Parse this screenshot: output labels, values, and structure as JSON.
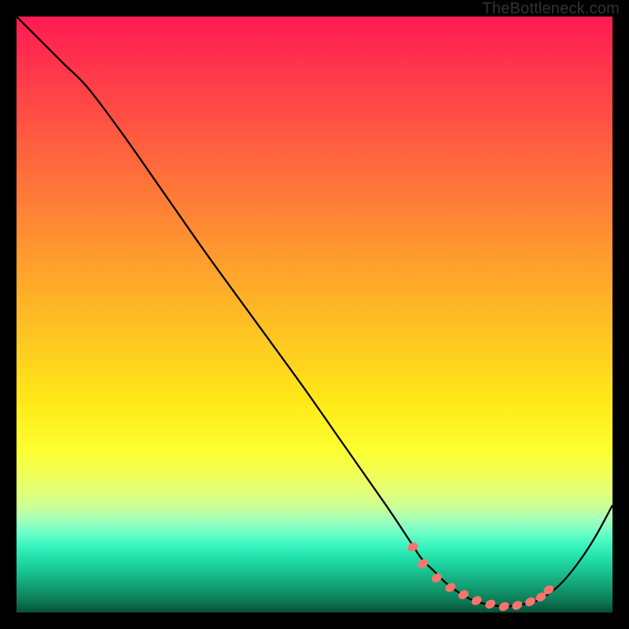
{
  "attribution": "TheBottleneck.com",
  "chart_data": {
    "type": "line",
    "title": "",
    "xlabel": "",
    "ylabel": "",
    "xlim": [
      0,
      100
    ],
    "ylim": [
      0,
      100
    ],
    "curve": {
      "x": [
        0,
        2,
        5,
        8,
        12,
        18,
        25,
        32,
        40,
        48,
        55,
        62,
        66,
        68,
        70,
        72,
        74,
        76,
        78,
        80,
        82,
        84,
        86,
        88,
        91,
        94,
        97,
        100
      ],
      "y": [
        100,
        98,
        95,
        92,
        88,
        80,
        70,
        60,
        49,
        38,
        28,
        18,
        12,
        9,
        7,
        5,
        3.5,
        2.3,
        1.6,
        1.2,
        1.0,
        1.2,
        1.6,
        2.3,
        4.5,
        8,
        12.5,
        18
      ]
    },
    "markers": {
      "x": [
        66.5,
        68.2,
        70.5,
        72.8,
        75.0,
        77.2,
        79.5,
        81.8,
        84.0,
        86.2,
        88.0,
        89.3
      ],
      "y": [
        11.0,
        8.2,
        5.8,
        4.2,
        3.0,
        2.0,
        1.4,
        1.0,
        1.2,
        1.8,
        2.6,
        3.8
      ]
    },
    "marker_color": "#f9746d",
    "curve_color": "#000000",
    "plot_background": "gradient-red-yellow-green"
  }
}
